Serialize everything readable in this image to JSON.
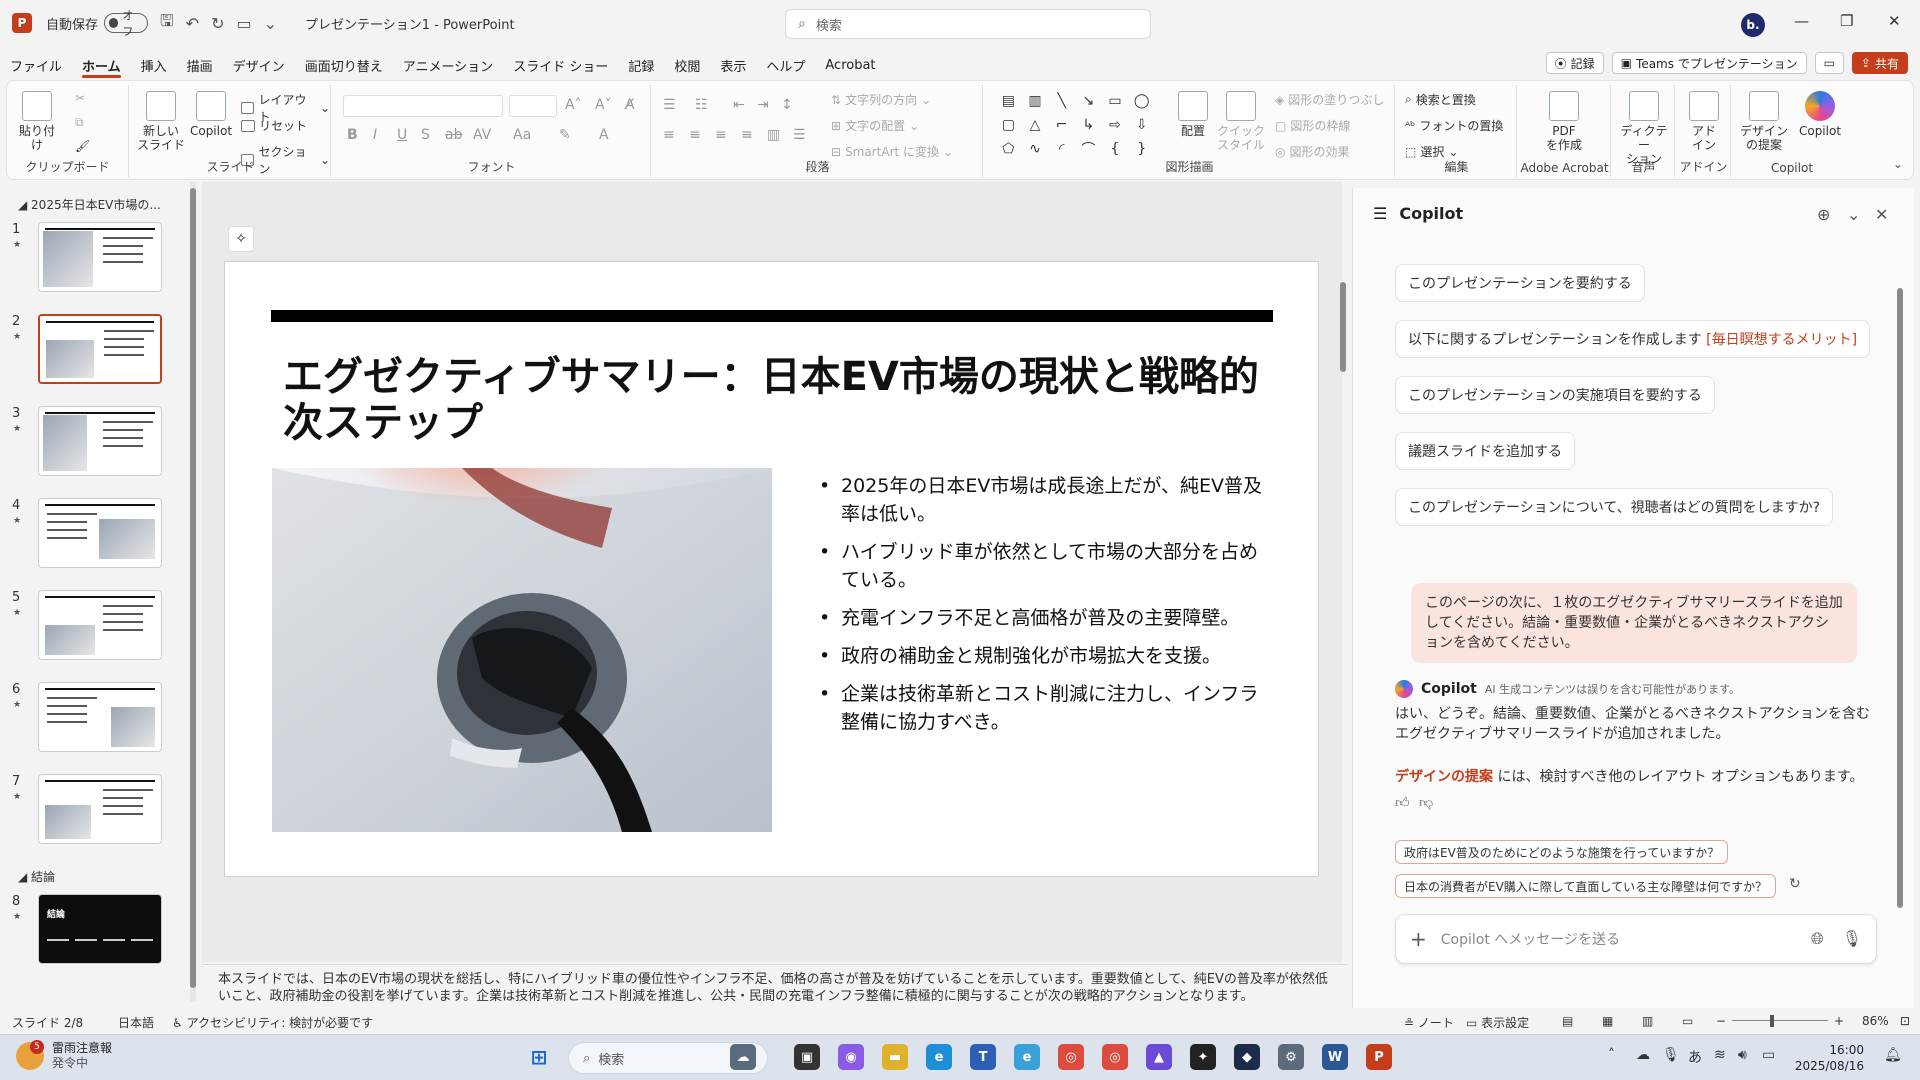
{
  "titlebar": {
    "autosave_label": "自動保存",
    "autosave_state": "オフ",
    "doc_title": "プレゼンテーション1  -  PowerPoint",
    "search_placeholder": "検索",
    "profile_initial": "b."
  },
  "menu": {
    "tabs": [
      "ファイル",
      "ホーム",
      "挿入",
      "描画",
      "デザイン",
      "画面切り替え",
      "アニメーション",
      "スライド ショー",
      "記録",
      "校閲",
      "表示",
      "ヘルプ",
      "Acrobat"
    ],
    "active": "ホーム",
    "record_label": "記録",
    "teams_label": "Teams でプレゼンテーション",
    "share_label": "共有"
  },
  "ribbon": {
    "clipboard": {
      "paste": "貼り付け",
      "label": "クリップボード"
    },
    "slides": {
      "new_slide": "新しい\nスライド",
      "copilot": "Copilot",
      "layout": "レイアウト",
      "reset": "リセット",
      "section": "セクション",
      "label": "スライド"
    },
    "font": {
      "label": "フォント"
    },
    "paragraph": {
      "text_direction": "文字列の方向",
      "align_text": "文字の配置",
      "smartart": "SmartArt に変換",
      "label": "段落"
    },
    "drawing": {
      "arrange": "配置",
      "quick_styles": "クイック\nスタイル",
      "shape_fill": "図形の塗りつぶし",
      "shape_outline": "図形の枠線",
      "shape_effects": "図形の効果",
      "label": "図形描画"
    },
    "editing": {
      "find_replace": "検索と置換",
      "replace_fonts": "フォントの置換",
      "select": "選択",
      "label": "編集"
    },
    "acrobat": {
      "create_pdf": "PDF\nを作成",
      "label": "Adobe Acrobat"
    },
    "voice": {
      "dictate": "ディクテー\nション",
      "label": "音声"
    },
    "addins": {
      "addins": "アド\nイン",
      "label": "アドイン"
    },
    "copilot_group": {
      "designer": "デザイン\nの提案",
      "copilot": "Copilot",
      "label": "Copilot"
    }
  },
  "thumbnails": {
    "section1": "2025年日本EV市場の...",
    "section2": "結論",
    "slides": [
      {
        "num": "1",
        "title": "2025年日本EV市場の現状と今後の展望"
      },
      {
        "num": "2",
        "title": "エグゼクティブサマリー：日本EV市場の現状と戦略的次ステップ"
      },
      {
        "num": "3",
        "title": "日本EV市場の現状：2025年の普及状況"
      },
      {
        "num": "4",
        "title": "ハイブリッド車の優位性と今後の行方"
      },
      {
        "num": "5",
        "title": "普及障壁：充電インフラと価格の課題"
      },
      {
        "num": "6",
        "title": "政府の補助金と規制強化の影響"
      },
      {
        "num": "7",
        "title": "今後の市場展望と企業の対応"
      },
      {
        "num": "8",
        "title": "結論"
      }
    ]
  },
  "slide": {
    "title": "エグゼクティブサマリー：日本EV市場の現状と戦略的次ステップ",
    "bullets": [
      "2025年の日本EV市場は成長途上だが、純EV普及率は低い。",
      "ハイブリッド車が依然として市場の大部分を占めている。",
      "充電インフラ不足と高価格が普及の主要障壁。",
      "政府の補助金と規制強化が市場拡大を支援。",
      "企業は技術革新とコスト削減に注力し、インフラ整備に協力すべき。"
    ]
  },
  "notes": "本スライドでは、日本のEV市場の現状を総括し、特にハイブリッド車の優位性やインフラ不足、価格の高さが普及を妨げていることを示しています。重要数値として、純EVの普及率が依然低いこと、政府補助金の役割を挙げています。企業は技術革新とコスト削減を推進し、公共・民間の充電インフラ整備に積極的に関与することが次の戦略的アクションとなります。",
  "copilot": {
    "title": "Copilot",
    "suggestions": [
      "このプレゼンテーションを要約する",
      "以下に関するプレゼンテーションを作成します",
      "このプレゼンテーションの実施項目を要約する",
      "議題スライドを追加する",
      "このプレゼンテーションについて、視聴者はどの質問をしますか?"
    ],
    "suggestion_highlight": "[毎日瞑想するメリット]",
    "user_message": "このページの次に、１枚のエグゼクティブサマリースライドを追加してください。結論・重要数値・企業がとるべきネクストアクションを含めてください。",
    "bot_name": "Copilot",
    "ai_disclaimer": "AI 生成コンテンツは誤りを含む可能性があります。",
    "bot_reply": "はい、どうぞ。結論、重要数値、企業がとるべきネクストアクションを含むエグゼクティブサマリースライドが追加されました。",
    "designer_link": "デザインの提案",
    "designer_rest": " には、検討すべき他のレイアウト オプションもあります。",
    "chips": [
      "政府はEV普及のためにどのような施策を行っていますか？",
      "日本の消費者がEV購入に際して直面している主な障壁は何ですか？"
    ],
    "input_placeholder": "Copilot へメッセージを送る"
  },
  "statusbar": {
    "slide_pos": "スライド 2/8",
    "language": "日本語",
    "accessibility": "アクセシビリティ: 検討が必要です",
    "notes": "ノート",
    "display_settings": "表示設定",
    "zoom": "86%"
  },
  "taskbar": {
    "weather_title": "雷雨注意報",
    "weather_sub": "発令中",
    "weather_badge": "5",
    "search_placeholder": "検索",
    "ime": "あ",
    "time": "16:00",
    "date": "2025/08/16"
  },
  "colors": {
    "accent": "#c43e1c",
    "user_bubble": "#fbe4dd"
  }
}
